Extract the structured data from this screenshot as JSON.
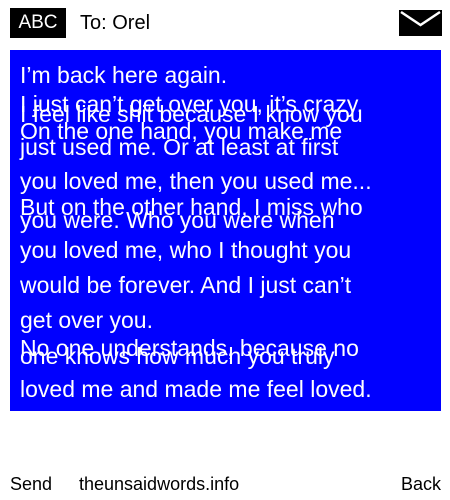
{
  "header": {
    "input_mode": "ABC",
    "recipient": "To: Orel",
    "icon": "envelope-icon"
  },
  "message": {
    "lines": [
      "I’m back here again.",
      "I just can’t get over you, it’s crazy.",
      "I feel like shit because I know you",
      "On the one hand, you make me",
      "just used me. Or at least at first",
      "you loved me, then you used me...",
      "But on the other hand, I miss who",
      "you were. Who you were when",
      "you loved me, who I thought you",
      "would be forever. And I just can’t",
      "get over you.",
      "No one understands, because no",
      "one knows how much you truly",
      "loved me and made me feel loved."
    ]
  },
  "softkeys": {
    "left": "Send",
    "center": "theunsaidwords.info",
    "right": "Back"
  },
  "colors": {
    "message_background": "#0000ff",
    "message_text": "#ffffff",
    "badge_background": "#000000"
  }
}
